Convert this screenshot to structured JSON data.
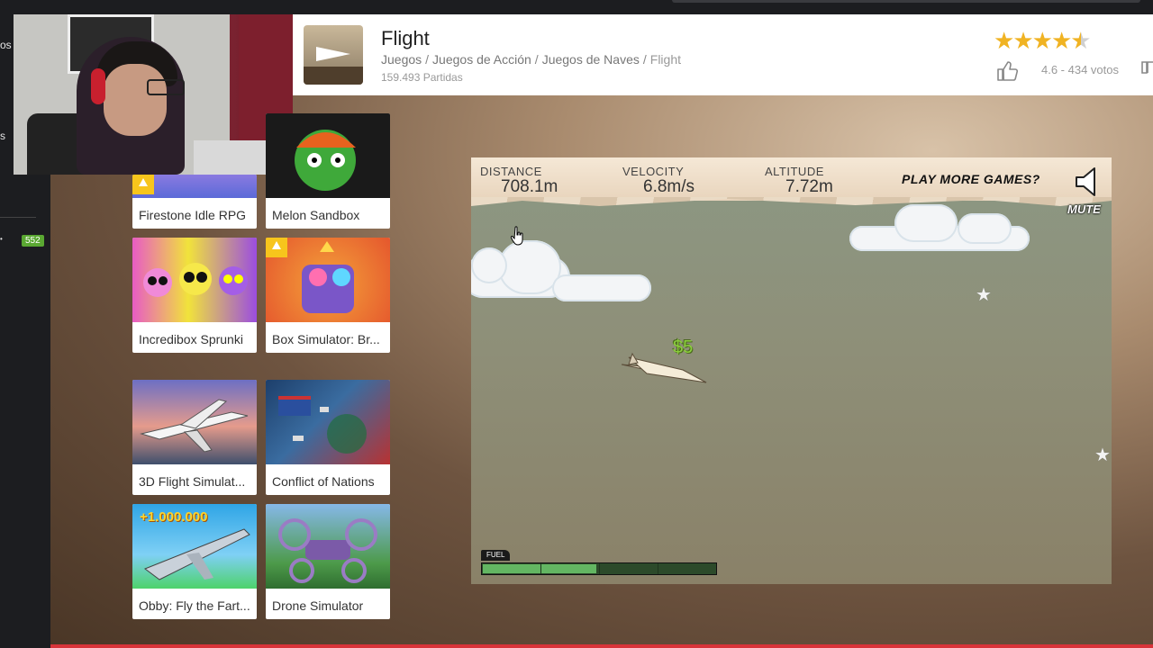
{
  "header": {
    "title": "Flight",
    "breadcrumb": [
      "Juegos",
      "Juegos de Acción",
      "Juegos de Naves",
      "Flight"
    ],
    "plays": "159.493 Partidas",
    "rating_value": 4.6,
    "rating_text": "4.6 - 434 votos"
  },
  "left_nav": {
    "text_fragments": [
      "os",
      "s"
    ],
    "badge": "552"
  },
  "games": [
    {
      "label": "Firestone Idle RPG",
      "badge": true
    },
    {
      "label": "Melon Sandbox",
      "badge": false
    },
    {
      "label": "Incredibox Sprunki",
      "badge": false
    },
    {
      "label": "Box Simulator: Br...",
      "badge": true
    },
    {
      "label": "3D Flight Simulat...",
      "badge": false
    },
    {
      "label": "Conflict of Nations",
      "badge": false
    },
    {
      "label": "Obby: Fly the Fart...",
      "badge": false
    },
    {
      "label": "Drone Simulator",
      "badge": false
    }
  ],
  "game_hud": {
    "distance_label": "DISTANCE",
    "distance_value": "708.1m",
    "velocity_label": "VELOCITY",
    "velocity_value": "6.8m/s",
    "altitude_label": "ALTITUDE",
    "altitude_value": "7.72m",
    "play_more": "PLAY MORE GAMES?",
    "mute_label": "MUTE",
    "money": "$5",
    "fuel_label": "FUEL",
    "fuel_fraction": 0.49
  },
  "colors": {
    "star": "#f0b323",
    "accent_red": "#d8343a",
    "fuel_green": "#63b662",
    "money_green": "#8ccf3e"
  },
  "icons": [
    "thumbs-up-icon",
    "thumbs-down-icon",
    "speaker-icon",
    "star-icon",
    "cursor-hand-icon",
    "new-badge-icon"
  ]
}
